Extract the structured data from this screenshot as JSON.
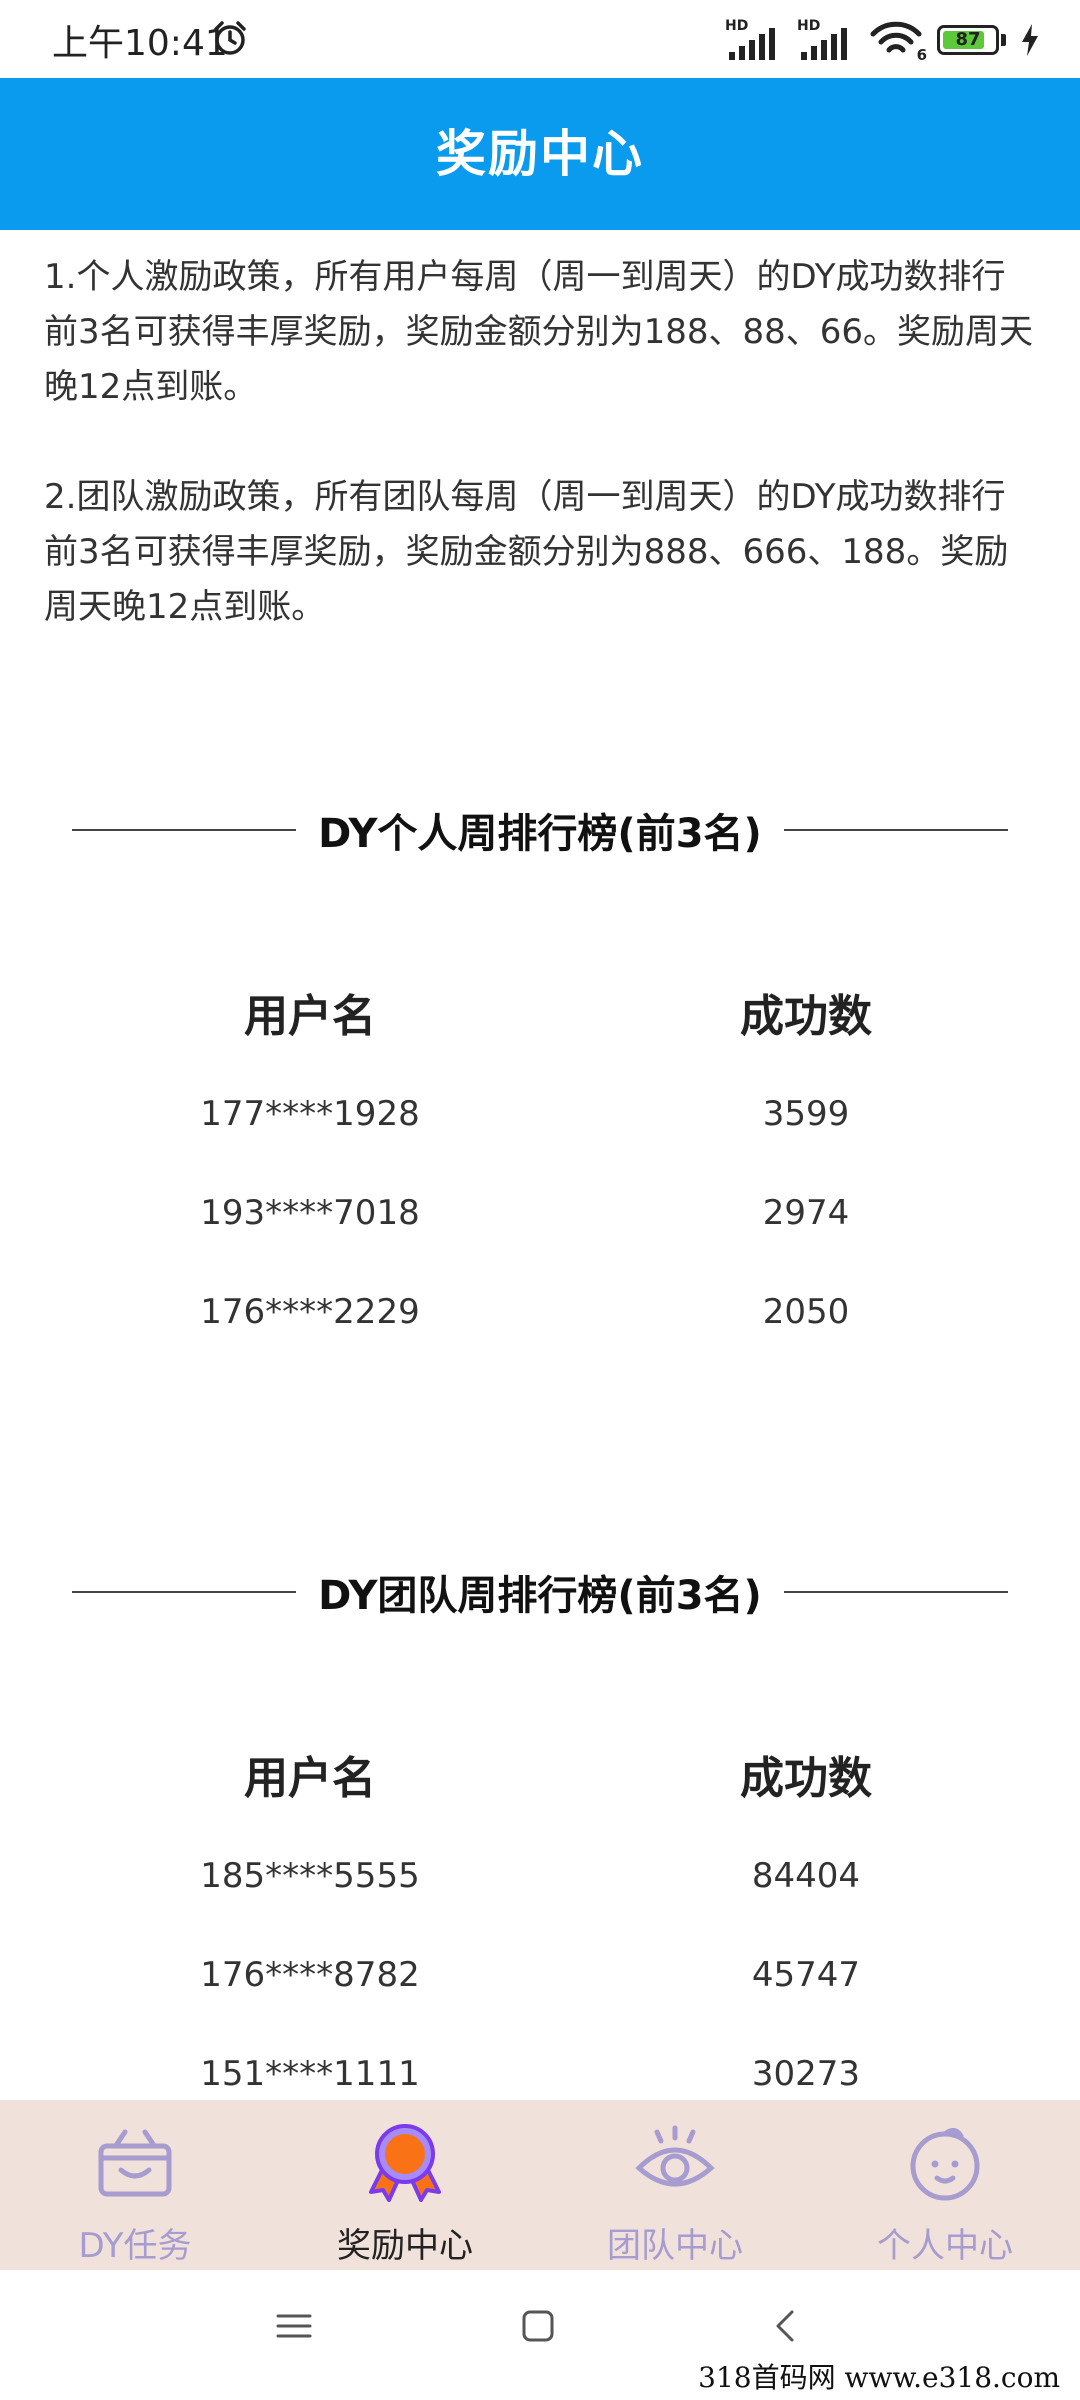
{
  "status_bar": {
    "time": "上午10:41",
    "hd1": "HD",
    "hd2": "HD",
    "wifi_badge": "6",
    "battery": "87"
  },
  "header": {
    "title": "奖励中心"
  },
  "policies": [
    "1.个人激励政策，所有用户每周（周一到周天）的DY成功数排行前3名可获得丰厚奖励，奖励金额分别为188、88、66。奖励周天晚12点到账。",
    "2.团队激励政策，所有团队每周（周一到周天）的DY成功数排行前3名可获得丰厚奖励，奖励金额分别为888、666、188。奖励周天晚12点到账。"
  ],
  "personal_ranking": {
    "title": "DY个人周排行榜(前3名)",
    "col_user": "用户名",
    "col_count": "成功数",
    "rows": [
      {
        "user": "177****1928",
        "count": "3599"
      },
      {
        "user": "193****7018",
        "count": "2974"
      },
      {
        "user": "176****2229",
        "count": "2050"
      }
    ]
  },
  "team_ranking": {
    "title": "DY团队周排行榜(前3名)",
    "col_user": "用户名",
    "col_count": "成功数",
    "rows": [
      {
        "user": "185****5555",
        "count": "84404"
      },
      {
        "user": "176****8782",
        "count": "45747"
      },
      {
        "user": "151****1111",
        "count": "30273"
      }
    ]
  },
  "tabs": [
    {
      "label": "DY任务",
      "icon": "gift-box-icon",
      "active": false
    },
    {
      "label": "奖励中心",
      "icon": "medal-icon",
      "active": true
    },
    {
      "label": "团队中心",
      "icon": "eye-icon",
      "active": false
    },
    {
      "label": "个人中心",
      "icon": "face-icon",
      "active": false
    }
  ],
  "watermark": "318首码网 www.e318.com",
  "colors": {
    "primary": "#0a9bee",
    "tab_bar_bg": "#f0e1da",
    "tab_inactive": "#a69ccf",
    "medal_orange": "#f97316",
    "medal_purple": "#7c3aed"
  }
}
